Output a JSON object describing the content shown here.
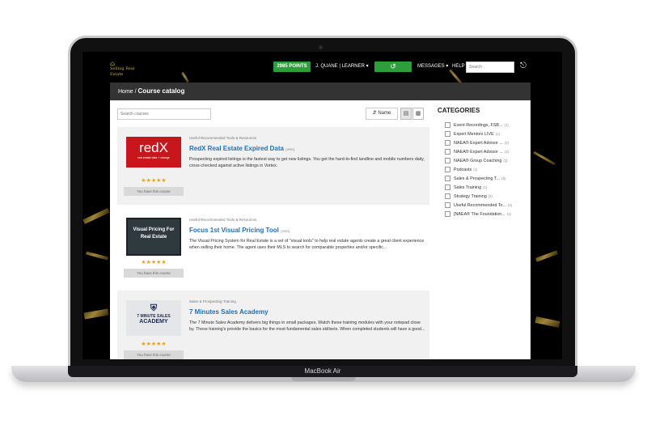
{
  "device": {
    "label": "MacBook Air"
  },
  "nav": {
    "logo_text": "Selling Real Estate",
    "points": "2985 POINTS",
    "user": "J. QUANE | LEARNER",
    "user_caret": "▾",
    "refresh_icon": "↺",
    "messages": "MESSAGES ▾",
    "help": "HELP",
    "search_placeholder": "Search",
    "logout_icon": "⎋"
  },
  "breadcrumb": {
    "home": "Home",
    "separator": " / ",
    "current": "Course catalog"
  },
  "catalog": {
    "search_placeholder": "Search courses",
    "sort_label": "Name",
    "sort_icon": "⇵",
    "view_list_icon": "▤",
    "view_grid_icon": "▦",
    "courses": [
      {
        "category": "Useful Recommended Tools & Resources",
        "title": "RedX Real Estate Expired Data",
        "tag": "(VRG)",
        "description": "Prospecting expired listings is the fastest way to get new listings. You get the hard-to-find landline and mobile numbers daily, cross-checked against active listings in Vortex.",
        "stars": "★★★★★",
        "status": "You have this course",
        "thumb_big": "redX",
        "thumb_small": "real estate data + change"
      },
      {
        "category": "Useful Recommended Tools & Resources",
        "title": "Focus 1st Visual Pricing Tool",
        "tag": "(VRG)",
        "description": "The Visual Pricing System for Real Estate is a set of \"visual tools\" to help real estate agents create a great client experience when selling their home. The agent uses their MLS to search for comparable properties and/or specific...",
        "stars": "★★★★★",
        "status": "You have this course",
        "thumb_text": "Visual Pricing For Real Estate"
      },
      {
        "category": "Sales & Prospecting Training",
        "title": "7 Minutes Sales Academy",
        "tag": "",
        "description": "The 7 Minute Sales Academy delivers big things in small packages. Watch these training modules with your notepad close by. These training's provide the basics for the most fundamental sales skillsets. When completed students will have a good...",
        "stars": "★★★★★",
        "status": "You have this course",
        "thumb_line1": "7 MINUTE SALES",
        "thumb_line2": "ACADEMY"
      }
    ]
  },
  "categories": {
    "title": "CATEGORIES",
    "items": [
      {
        "label": "Event Recordings, FSB...",
        "count": "(1)"
      },
      {
        "label": "Expert Mentors LIVE",
        "count": "(1)"
      },
      {
        "label": "NAEA® Expert Advisor ...",
        "count": "(2)"
      },
      {
        "label": "NAEA® Expert Advisor ...",
        "count": "(2)"
      },
      {
        "label": "NAEA® Group Coaching",
        "count": "(3)"
      },
      {
        "label": "Podcasts",
        "count": "(1)"
      },
      {
        "label": "Sales & Prospecting T...",
        "count": "(6)"
      },
      {
        "label": "Sales Training",
        "count": "(1)"
      },
      {
        "label": "Strategy Training",
        "count": "(2)"
      },
      {
        "label": "Useful Recommended To...",
        "count": "(4)"
      },
      {
        "label": "[NAEA® The Foundation...",
        "count": "(1)"
      }
    ]
  }
}
